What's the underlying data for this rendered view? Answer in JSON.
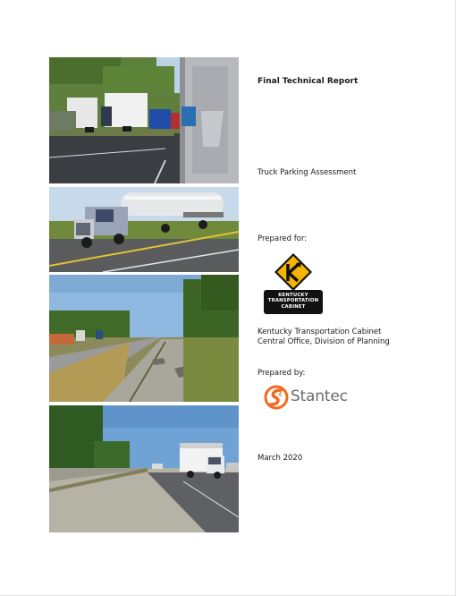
{
  "report": {
    "title": "Final Technical Report",
    "subtitle": "Truck Parking Assessment",
    "prepared_for_label": "Prepared for:",
    "client_line1": "Kentucky Transportation Cabinet",
    "client_line2": "Central Office, Division of Planning",
    "prepared_by_label": "Prepared by:",
    "date": "March 2020"
  },
  "logos": {
    "kytc": {
      "letter": "K",
      "line1": "KENTUCKY",
      "line2": "TRANSPORTATION",
      "line3": "CABINET",
      "sign_color": "#f5b400"
    },
    "stantec": {
      "name": "Stantec",
      "mark_color": "#f26a21"
    }
  }
}
